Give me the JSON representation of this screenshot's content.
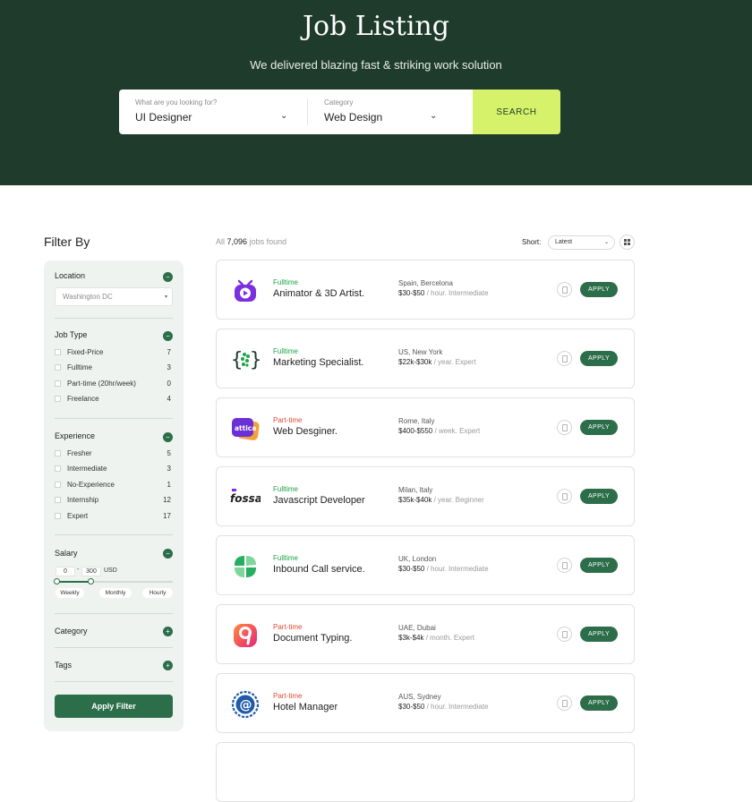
{
  "hero": {
    "title": "Job Listing",
    "subtitle": "We delivered blazing fast & striking work solution",
    "search": {
      "keyword_label": "What are you looking for?",
      "keyword_value": "UI Designer",
      "category_label": "Category",
      "category_value": "Web Design",
      "button_label": "SEARCH"
    }
  },
  "filters": {
    "heading": "Filter By",
    "location": {
      "title": "Location",
      "selected": "Washington DC",
      "toggle": "−"
    },
    "job_type": {
      "title": "Job Type",
      "toggle": "−",
      "options": [
        {
          "label": "Fixed-Price",
          "count": "7"
        },
        {
          "label": "Fulltime",
          "count": "3"
        },
        {
          "label": "Part-time (20hr/week)",
          "count": "0"
        },
        {
          "label": "Freelance",
          "count": "4"
        }
      ]
    },
    "experience": {
      "title": "Experience",
      "toggle": "−",
      "options": [
        {
          "label": "Fresher",
          "count": "5"
        },
        {
          "label": "Intermediate",
          "count": "3"
        },
        {
          "label": "No-Experience",
          "count": "1"
        },
        {
          "label": "Internship",
          "count": "12"
        },
        {
          "label": "Expert",
          "count": "17"
        }
      ]
    },
    "salary": {
      "title": "Salary",
      "toggle": "−",
      "min": "0",
      "max": "300",
      "unit": "USD",
      "range_fraction": [
        0,
        0.3
      ],
      "periods": [
        "Weekly",
        "Monthly",
        "Hourly"
      ]
    },
    "category": {
      "title": "Category",
      "toggle": "+"
    },
    "tags": {
      "title": "Tags",
      "toggle": "+"
    },
    "apply_label": "Apply Filter"
  },
  "results": {
    "prefix": "All",
    "count": "7,096",
    "suffix": "jobs found",
    "sort_label": "Short:",
    "sort_value": "Latest"
  },
  "colors": {
    "fulltime": "#1ea34a",
    "parttime": "#e04a3a",
    "primary": "#2c6e49",
    "accent": "#d6f26b"
  },
  "jobs": [
    {
      "type": "Fulltime",
      "title": "Animator & 3D Artist.",
      "location": "Spain, Bercelona",
      "salary": "$30-$50",
      "period": "/ hour. Intermediate",
      "logo": "twitch-tv-icon",
      "apply": "APPLY"
    },
    {
      "type": "Fulltime",
      "title": "Marketing Specialist.",
      "location": "US, New York",
      "salary": "$22k-$30k",
      "period": "/ year. Expert",
      "logo": "slack-dots-icon",
      "apply": "APPLY"
    },
    {
      "type": "Part-time",
      "title": "Web Desginer.",
      "location": "Rome, Italy",
      "salary": "$400-$550",
      "period": "/ week. Expert",
      "logo": "attica-icon",
      "logo_text": "attica",
      "apply": "APPLY"
    },
    {
      "type": "Fulltime",
      "title": "Javascript Developer",
      "location": "Milan, Italy",
      "salary": "$35k-$40k",
      "period": "/ year. Beginner",
      "logo": "fossa-icon",
      "logo_text": "fossa",
      "apply": "APPLY"
    },
    {
      "type": "Fulltime",
      "title": "Inbound Call service.",
      "location": "UK, London",
      "salary": "$30-$50",
      "period": "/ hour. Intermediate",
      "logo": "leaf-icon",
      "apply": "APPLY"
    },
    {
      "type": "Part-time",
      "title": "Document Typing.",
      "location": "UAE, Dubai",
      "salary": "$3k-$4k",
      "period": "/ month. Expert",
      "logo": "nine-icon",
      "logo_text": "9",
      "apply": "APPLY"
    },
    {
      "type": "Part-time",
      "title": "Hotel Manager",
      "location": "AUS, Sydney",
      "salary": "$30-$50",
      "period": "/ hour. Intermediate",
      "logo": "at-seal-icon",
      "logo_text": "@",
      "apply": "APPLY"
    }
  ]
}
